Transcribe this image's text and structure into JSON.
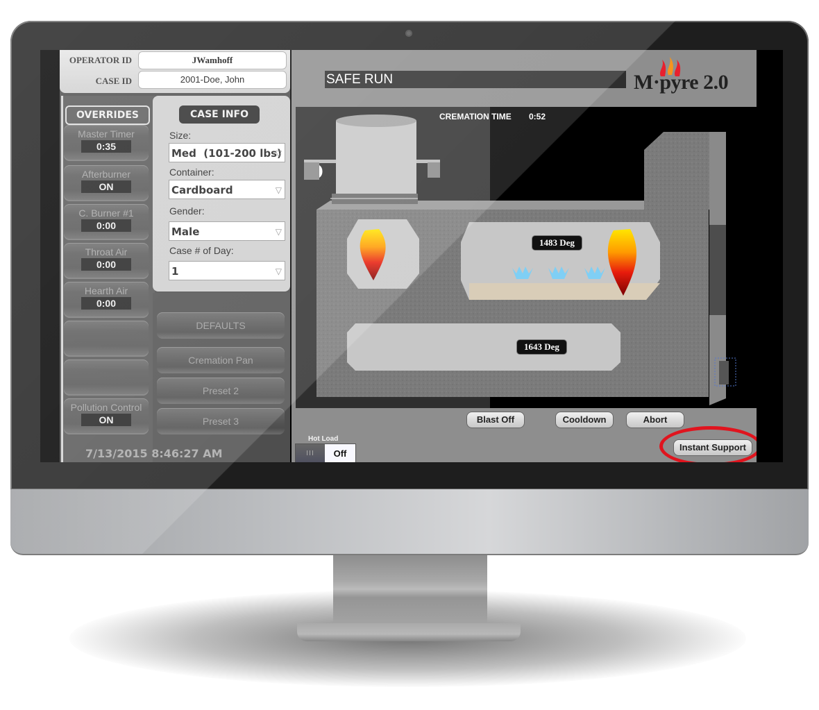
{
  "header": {
    "operator_id_label": "OPERATOR ID",
    "operator_id_value": "JWamhoff",
    "case_id_label": "CASE ID",
    "case_id_value": "2001-Doe, John"
  },
  "overrides": {
    "title": "OVERRIDES",
    "items": [
      {
        "label": "Master Timer",
        "value": "0:35"
      },
      {
        "label": "Afterburner",
        "value": "ON"
      },
      {
        "label": "C. Burner #1",
        "value": "0:00"
      },
      {
        "label": "Throat Air",
        "value": "0:00"
      },
      {
        "label": "Hearth Air",
        "value": "0:00"
      },
      {
        "label": "",
        "value": ""
      },
      {
        "label": "",
        "value": ""
      },
      {
        "label": "Pollution Control",
        "value": "ON"
      }
    ]
  },
  "case_info": {
    "title": "CASE INFO",
    "fields": [
      {
        "label": "Size:",
        "value": "Med  (101-200 lbs)"
      },
      {
        "label": "Container:",
        "value": "Cardboard"
      },
      {
        "label": "Gender:",
        "value": "Male"
      },
      {
        "label": "Case # of Day:",
        "value": "1"
      }
    ]
  },
  "presets": {
    "defaults": "DEFAULTS",
    "items": [
      "Cremation Pan",
      "Preset 2",
      "Preset 3"
    ]
  },
  "datetime": "7/13/2015 8:46:27 AM",
  "status": "SAFE RUN",
  "logo": {
    "text": "M·pyre 2.0",
    "flame_colors": [
      "#e8212e",
      "#f7941d",
      "#e8212e"
    ]
  },
  "cremation": {
    "label": "CREMATION TIME",
    "value": "0:52",
    "primary_temp": "1483 Deg",
    "secondary_temp": "1643 Deg"
  },
  "actions": {
    "blast_off": "Blast Off",
    "cooldown": "Cooldown",
    "abort": "Abort",
    "instant_support": "Instant Support"
  },
  "hot_load": {
    "label": "Hot Load",
    "off_glyph": "III",
    "state": "Off"
  },
  "colors": {
    "highlight": "#e0141e",
    "air_jets": "#7fcff5",
    "hearth": "#d9cdb8"
  }
}
